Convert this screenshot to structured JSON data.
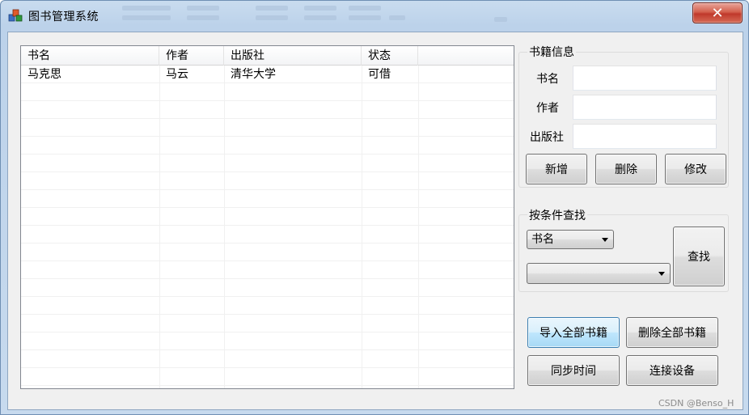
{
  "window": {
    "title": "图书管理系统",
    "close_icon": "close-icon"
  },
  "book_list": {
    "columns": [
      "书名",
      "作者",
      "出版社",
      "状态",
      ""
    ],
    "rows": [
      [
        "马克思",
        "马云",
        "清华大学",
        "可借",
        ""
      ]
    ]
  },
  "book_info": {
    "group_title": "书籍信息",
    "title_label": "书名",
    "title_value": "",
    "author_label": "作者",
    "author_value": "",
    "publisher_label": "出版社",
    "publisher_value": "",
    "add_label": "新增",
    "delete_label": "删除",
    "edit_label": "修改"
  },
  "search": {
    "group_title": "按条件查找",
    "field_selected": "书名",
    "value_selected": "",
    "search_label": "查找"
  },
  "actions": {
    "import_all_label": "导入全部书籍",
    "delete_all_label": "删除全部书籍",
    "sync_time_label": "同步时间",
    "connect_label": "连接设备"
  },
  "watermark": "CSDN @Benso_H",
  "colors": {
    "focused_button_border": "#3c7fb1",
    "close_button": "#c0392b",
    "title_bar": "#c9dcef"
  }
}
